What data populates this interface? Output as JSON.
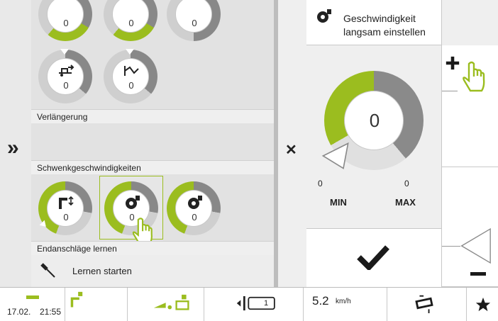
{
  "nav": {
    "expand_glyph": "»",
    "close_glyph": "✕"
  },
  "dial_rows": {
    "row1": [
      "0",
      "0",
      "0"
    ],
    "row2": [
      "0",
      "0"
    ],
    "swivel": [
      "0",
      "0",
      "0"
    ]
  },
  "sections": {
    "extension": "Verlängerung",
    "swivel_speeds": "Schwenkgeschwindigkeiten",
    "end_stops": "Endanschläge lernen",
    "start_learning": "Lernen starten"
  },
  "detail": {
    "title": "Geschwindigkeit langsam einstellen",
    "value": "0",
    "min_value": "0",
    "max_value": "0",
    "min_label": "MIN",
    "max_label": "MAX",
    "level_fraction": 0.5
  },
  "footer": {
    "date": "17.02.",
    "time": "21:55",
    "speed": "5.2",
    "speed_unit": "km/h",
    "gear": "1"
  },
  "colors": {
    "accent": "#9bbd1f",
    "dark": "#1a1a1a",
    "grey": "#8f8f8f"
  }
}
